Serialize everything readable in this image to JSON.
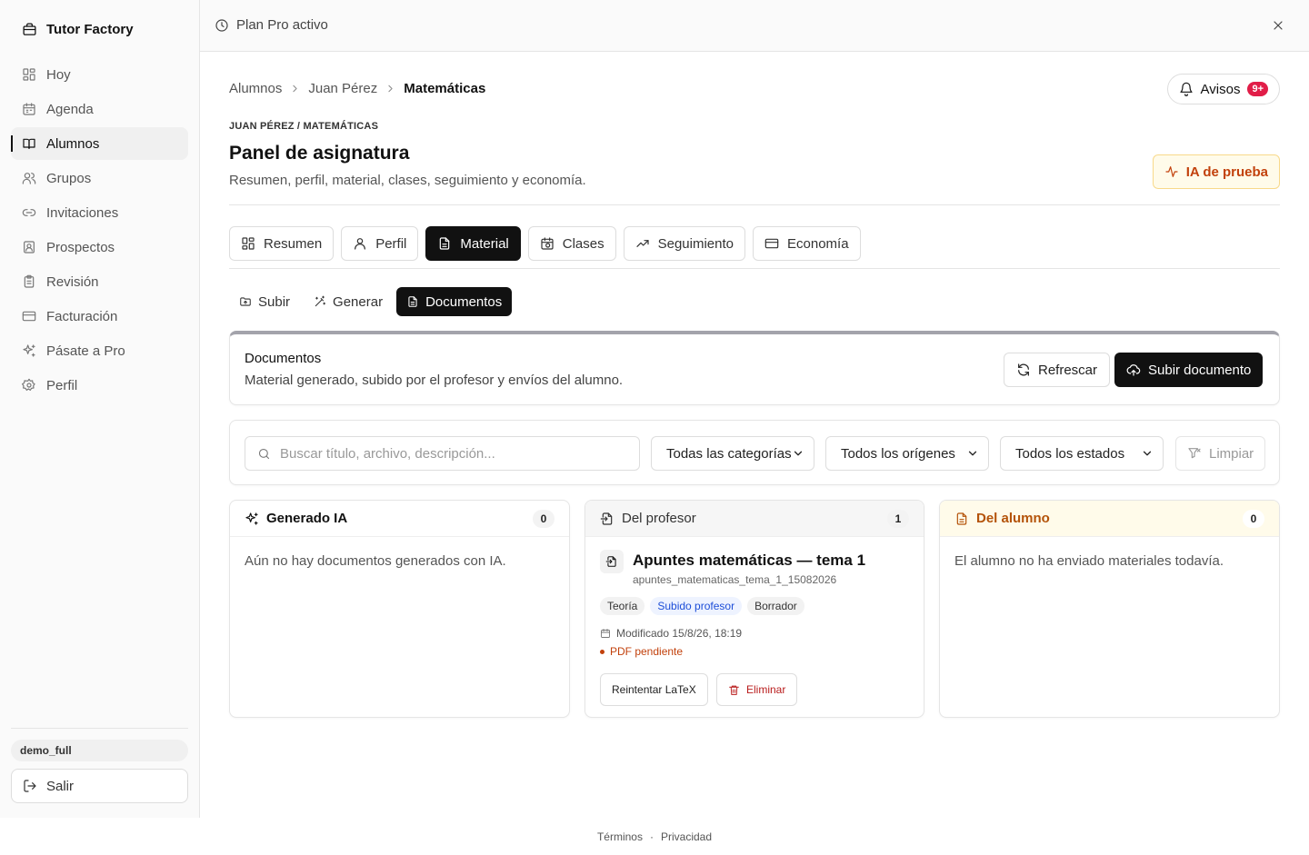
{
  "app": {
    "name": "Tutor Factory"
  },
  "sidebar": {
    "items": [
      {
        "label": "Hoy",
        "icon": "dashboard-icon"
      },
      {
        "label": "Agenda",
        "icon": "calendar-icon"
      },
      {
        "label": "Alumnos",
        "icon": "book-open-icon",
        "active": true
      },
      {
        "label": "Grupos",
        "icon": "users-icon"
      },
      {
        "label": "Invitaciones",
        "icon": "link-icon"
      },
      {
        "label": "Prospectos",
        "icon": "contact-icon"
      },
      {
        "label": "Revisión",
        "icon": "clipboard-icon"
      },
      {
        "label": "Facturación",
        "icon": "credit-card-icon"
      },
      {
        "label": "Pásate a Pro",
        "icon": "sparkles-icon"
      },
      {
        "label": "Perfil",
        "icon": "gear-icon"
      }
    ],
    "user": "demo_full",
    "logout": "Salir"
  },
  "topbar": {
    "plan": "Plan Pro activo"
  },
  "breadcrumb": [
    "Alumnos",
    "Juan Pérez",
    "Matemáticas"
  ],
  "notifications": {
    "label": "Avisos",
    "count": "9+"
  },
  "header": {
    "eyebrow": "JUAN PÉREZ / MATEMÁTICAS",
    "title": "Panel de asignatura",
    "subtitle": "Resumen, perfil, material, clases, seguimiento y economía.",
    "ia_badge": "IA de prueba"
  },
  "tabs": [
    {
      "label": "Resumen"
    },
    {
      "label": "Perfil"
    },
    {
      "label": "Material",
      "active": true
    },
    {
      "label": "Clases"
    },
    {
      "label": "Seguimiento"
    },
    {
      "label": "Economía"
    }
  ],
  "subtabs": [
    {
      "label": "Subir"
    },
    {
      "label": "Generar"
    },
    {
      "label": "Documentos",
      "active": true
    }
  ],
  "documents": {
    "title": "Documentos",
    "description": "Material generado, subido por el profesor y envíos del alumno.",
    "refresh": "Refrescar",
    "upload": "Subir documento"
  },
  "filters": {
    "search_placeholder": "Buscar título, archivo, descripción...",
    "category": "Todas las categorías",
    "origin": "Todos los orígenes",
    "status": "Todos los estados",
    "clear": "Limpiar"
  },
  "columns": {
    "ia": {
      "title": "Generado IA",
      "count": "0",
      "empty": "Aún no hay documentos generados con IA."
    },
    "teacher": {
      "title": "Del profesor",
      "count": "1",
      "doc": {
        "title": "Apuntes matemáticas — tema 1",
        "file": "apuntes_matematicas_tema_1_15082026",
        "chips": [
          "Teoría",
          "Subido profesor",
          "Borrador"
        ],
        "modified": "Modificado 15/8/26, 18:19",
        "pending": "PDF pendiente",
        "retry": "Reintentar LaTeX",
        "delete": "Eliminar"
      }
    },
    "student": {
      "title": "Del alumno",
      "count": "0",
      "empty": "El alumno no ha enviado materiales todavía."
    }
  },
  "footer": {
    "terms": "Términos",
    "sep": "·",
    "privacy": "Privacidad"
  },
  "colors": {
    "accent": "#111111",
    "warning": "#c2410c",
    "danger": "#b91c1c",
    "badge": "#e11d48",
    "info": "#1d4ed8"
  }
}
